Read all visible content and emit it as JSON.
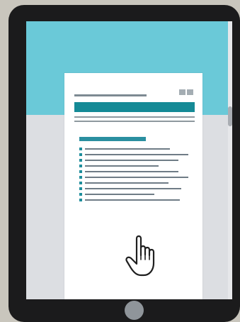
{
  "device": {
    "type": "tablet",
    "icons": [
      "home-button-icon",
      "pointer-hand-icon",
      "scrollbar-icon"
    ]
  },
  "document": {
    "blocks": {
      "header": "placeholder-lines",
      "title_bar": "teal-filled",
      "list_items": 10
    }
  },
  "colors": {
    "frame": "#1b1b1c",
    "band": "#6ac9d8",
    "screen": "#dcdee2",
    "accent": "#158a96",
    "lines": "#6f7c86",
    "background": "#c9c6bd"
  }
}
